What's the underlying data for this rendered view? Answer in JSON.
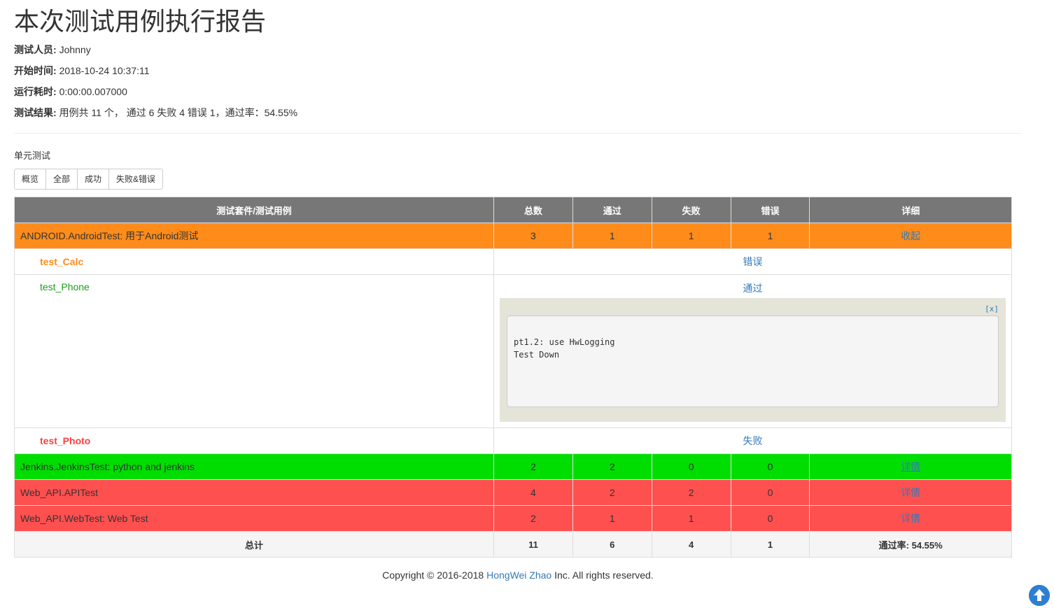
{
  "title": "本次测试用例执行报告",
  "meta": [
    {
      "label": "测试人员:",
      "value": "Johnny"
    },
    {
      "label": "开始时间:",
      "value": "2018-10-24 10:37:11"
    },
    {
      "label": "运行耗时:",
      "value": "0:00:00.007000"
    },
    {
      "label": "测试结果:",
      "value": "用例共 11 个， 通过 6 失败 4 错误 1，通过率：54.55%"
    }
  ],
  "section_label": "单元测试",
  "filter_buttons": [
    "概览",
    "全部",
    "成功",
    "失败&错误"
  ],
  "table": {
    "headers": [
      "测试套件/测试用例",
      "总数",
      "通过",
      "失败",
      "错误",
      "详细"
    ],
    "suites": [
      {
        "name": "ANDROID.AndroidTest: 用于Android测试",
        "total": "3",
        "pass": "1",
        "fail": "1",
        "error": "1",
        "detail": "收起",
        "color": "#ff8c1a"
      },
      {
        "name": "Jenkins.JenkinsTest: python and jenkins",
        "total": "2",
        "pass": "2",
        "fail": "0",
        "error": "0",
        "detail": "详情",
        "color": "#00dd00"
      },
      {
        "name": "Web_API.APITest",
        "total": "4",
        "pass": "2",
        "fail": "2",
        "error": "0",
        "detail": "详情",
        "color": "#ff5050"
      },
      {
        "name": "Web_API.WebTest: Web Test",
        "total": "2",
        "pass": "1",
        "fail": "1",
        "error": "0",
        "detail": "详情",
        "color": "#ff5050"
      }
    ],
    "cases": [
      {
        "name": "test_Calc",
        "status": "错误"
      },
      {
        "name": "test_Phone",
        "status": "通过",
        "output_close": "[x]",
        "output_lines": "pt1.2: use HwLogging\nTest Down"
      },
      {
        "name": "test_Photo",
        "status": "失败"
      }
    ],
    "total_row": {
      "label": "总计",
      "total": "11",
      "pass": "6",
      "fail": "4",
      "error": "1",
      "rate": "通过率: 54.55%"
    }
  },
  "footer": {
    "prefix": "Copyright © 2016-2018 ",
    "author": "HongWei Zhao",
    "suffix": " Inc. All rights reserved."
  },
  "scroll_top_icon": "arrow-up-circle-icon"
}
